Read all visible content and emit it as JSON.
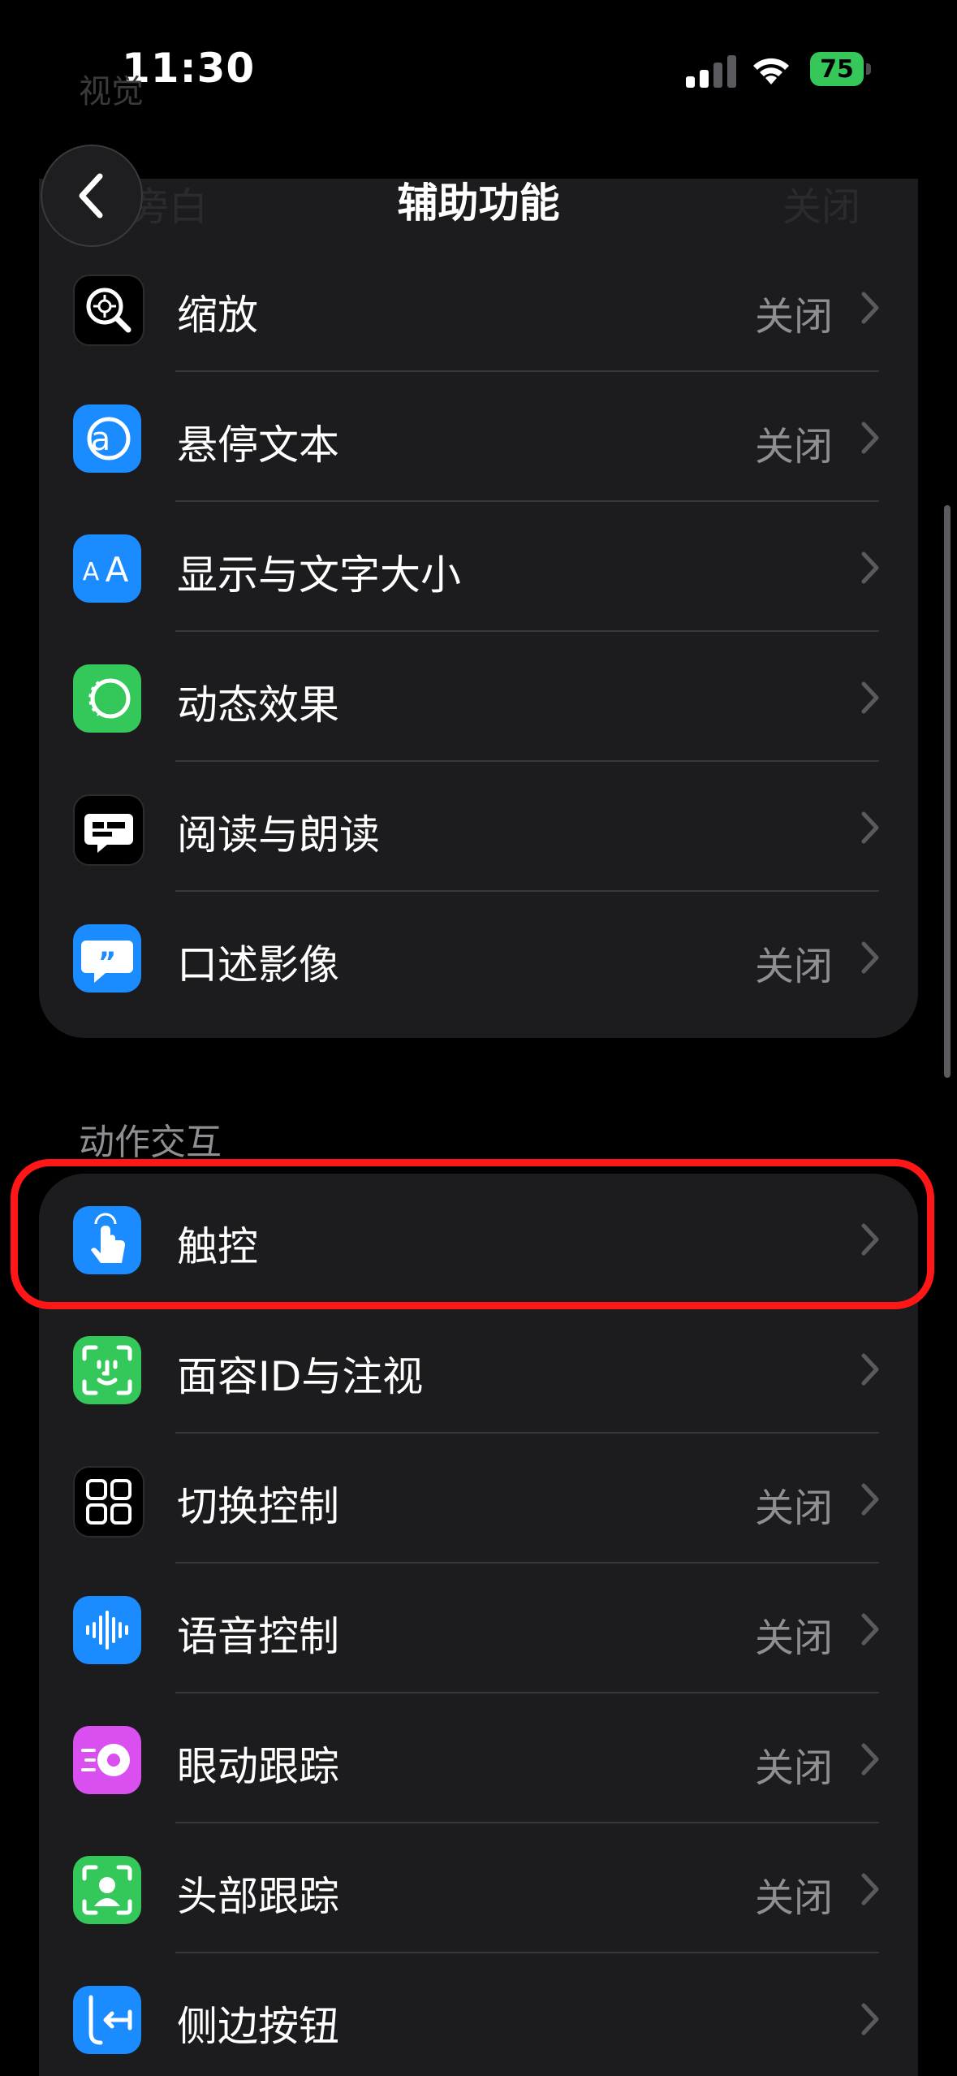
{
  "status_bar": {
    "time": "11:30",
    "battery": "75"
  },
  "ghost": {
    "top_text": "视觉",
    "row_label": "旁白",
    "row_value": "关闭"
  },
  "nav": {
    "title": "辅助功能"
  },
  "vision_rows": [
    {
      "label": "缩放",
      "value": "关闭",
      "icon": "zoom-icon",
      "color": "#000000"
    },
    {
      "label": "悬停文本",
      "value": "关闭",
      "icon": "hover-text-icon",
      "color": "#1a8cff"
    },
    {
      "label": "显示与文字大小",
      "value": "",
      "icon": "text-size-icon",
      "color": "#1a8cff"
    },
    {
      "label": "动态效果",
      "value": "",
      "icon": "motion-icon",
      "color": "#34c759"
    },
    {
      "label": "阅读与朗读",
      "value": "",
      "icon": "speech-bubble-icon",
      "color": "#000000"
    },
    {
      "label": "口述影像",
      "value": "关闭",
      "icon": "audio-description-icon",
      "color": "#1a8cff"
    }
  ],
  "section_header": "动作交互",
  "interaction_rows": [
    {
      "label": "触控",
      "value": "",
      "icon": "touch-hand-icon",
      "color": "#1a8cff"
    },
    {
      "label": "面容ID与注视",
      "value": "",
      "icon": "face-id-icon",
      "color": "#34c759"
    },
    {
      "label": "切换控制",
      "value": "关闭",
      "icon": "switch-control-icon",
      "color": "#000000"
    },
    {
      "label": "语音控制",
      "value": "关闭",
      "icon": "voice-control-icon",
      "color": "#1a8cff"
    },
    {
      "label": "眼动跟踪",
      "value": "关闭",
      "icon": "eye-tracking-icon",
      "color": "#d94ff0"
    },
    {
      "label": "头部跟踪",
      "value": "关闭",
      "icon": "head-tracking-icon",
      "color": "#34c759"
    },
    {
      "label": "侧边按钮",
      "value": "",
      "icon": "side-button-icon",
      "color": "#1a8cff"
    }
  ],
  "colors": {
    "background": "#000000",
    "group": "#1c1c1e",
    "secondary_text": "#8e8e93",
    "highlight": "#ff1616"
  }
}
